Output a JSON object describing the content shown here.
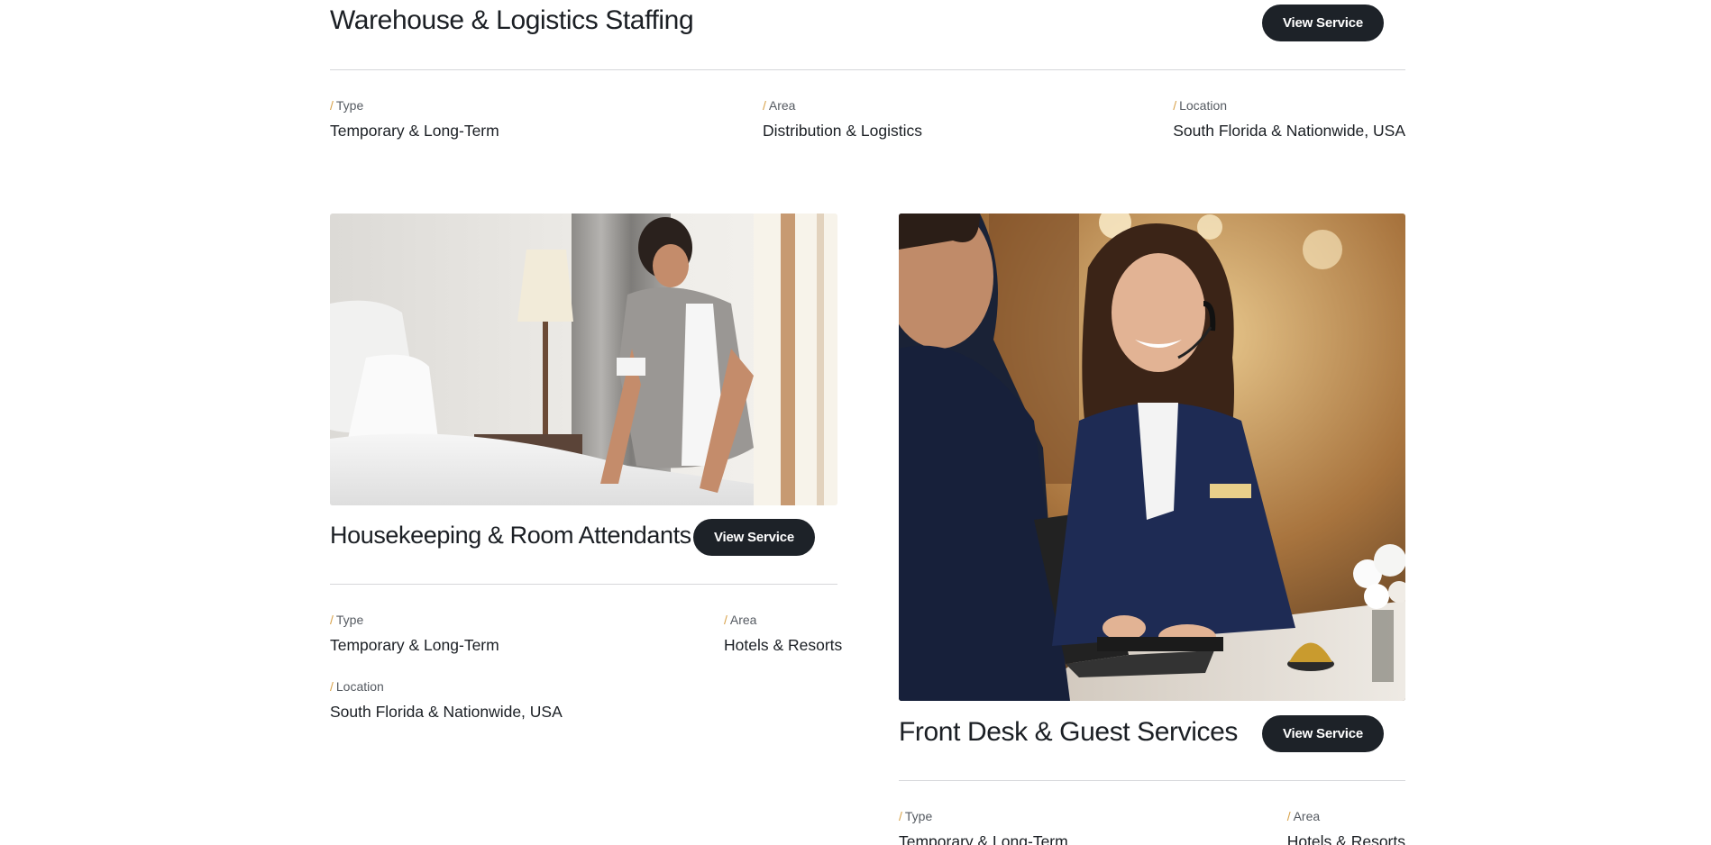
{
  "services": [
    {
      "title": "Warehouse & Logistics Staffing",
      "button_label": "View Service",
      "type_label": "Type",
      "type_value": "Temporary & Long-Term",
      "area_label": "Area",
      "area_value": "Distribution & Logistics",
      "location_label": "Location",
      "location_value": "South Florida & Nationwide, USA"
    },
    {
      "title": "Housekeeping & Room Attendants",
      "button_label": "View Service",
      "image_alt": "housekeeper-making-bed-photo",
      "type_label": "Type",
      "type_value": "Temporary & Long-Term",
      "area_label": "Area",
      "area_value": "Hotels & Resorts",
      "location_label": "Location",
      "location_value": "South Florida & Nationwide, USA"
    },
    {
      "title": "Front Desk & Guest Services",
      "button_label": "View Service",
      "image_alt": "front-desk-receptionist-photo",
      "type_label": "Type",
      "type_value": "Temporary & Long-Term",
      "area_label": "Area",
      "area_value": "Hotels & Resorts"
    }
  ],
  "label_prefix": "/",
  "colors": {
    "text": "#1b1f24",
    "muted": "#555a61",
    "accent_slash": "#d8a24a",
    "button_bg": "#1d2228",
    "button_text": "#ffffff",
    "divider": "#d6d7da"
  }
}
